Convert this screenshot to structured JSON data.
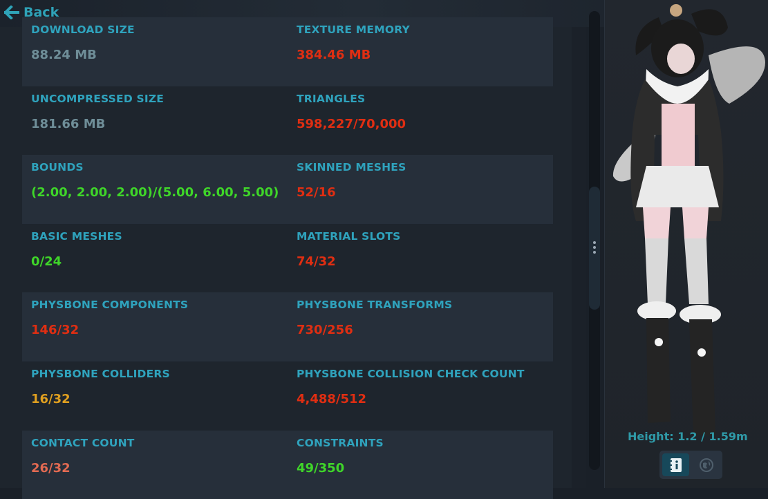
{
  "nav": {
    "back_label": "Back"
  },
  "colors": {
    "label": "#2fa3bd",
    "neutral": "#6f8e98",
    "good": "#3fd629",
    "medium": "#e0a020",
    "bad": "#e02e12",
    "bad_soft": "#e26a52",
    "accent": "#2f9aa8"
  },
  "stats": [
    {
      "left": {
        "label": "DOWNLOAD SIZE",
        "value": "88.24 MB",
        "status": "neutral"
      },
      "right": {
        "label": "TEXTURE MEMORY",
        "value": "384.46 MB",
        "status": "bad"
      }
    },
    {
      "left": {
        "label": "UNCOMPRESSED SIZE",
        "value": "181.66 MB",
        "status": "neutral"
      },
      "right": {
        "label": "TRIANGLES",
        "value": "598,227/70,000",
        "status": "bad"
      }
    },
    {
      "left": {
        "label": "BOUNDS",
        "value": "(2.00, 2.00, 2.00)/(5.00, 6.00, 5.00)",
        "status": "good"
      },
      "right": {
        "label": "SKINNED MESHES",
        "value": "52/16",
        "status": "bad"
      }
    },
    {
      "left": {
        "label": "BASIC MESHES",
        "value": "0/24",
        "status": "good"
      },
      "right": {
        "label": "MATERIAL SLOTS",
        "value": "74/32",
        "status": "bad"
      }
    },
    {
      "left": {
        "label": "PHYSBONE COMPONENTS",
        "value": "146/32",
        "status": "bad"
      },
      "right": {
        "label": "PHYSBONE TRANSFORMS",
        "value": "730/256",
        "status": "bad"
      }
    },
    {
      "left": {
        "label": "PHYSBONE COLLIDERS",
        "value": "16/32",
        "status": "medium"
      },
      "right": {
        "label": "PHYSBONE COLLISION CHECK COUNT",
        "value": "4,488/512",
        "status": "bad"
      }
    },
    {
      "left": {
        "label": "CONTACT COUNT",
        "value": "26/32",
        "status": "bad_soft"
      },
      "right": {
        "label": "CONSTRAINTS",
        "value": "49/350",
        "status": "good"
      }
    }
  ],
  "preview": {
    "height_text": "Height: 1.2 / 1.59m",
    "tabs": [
      {
        "icon": "info-book-icon",
        "active": true
      },
      {
        "icon": "globe-icon",
        "active": false
      }
    ]
  }
}
